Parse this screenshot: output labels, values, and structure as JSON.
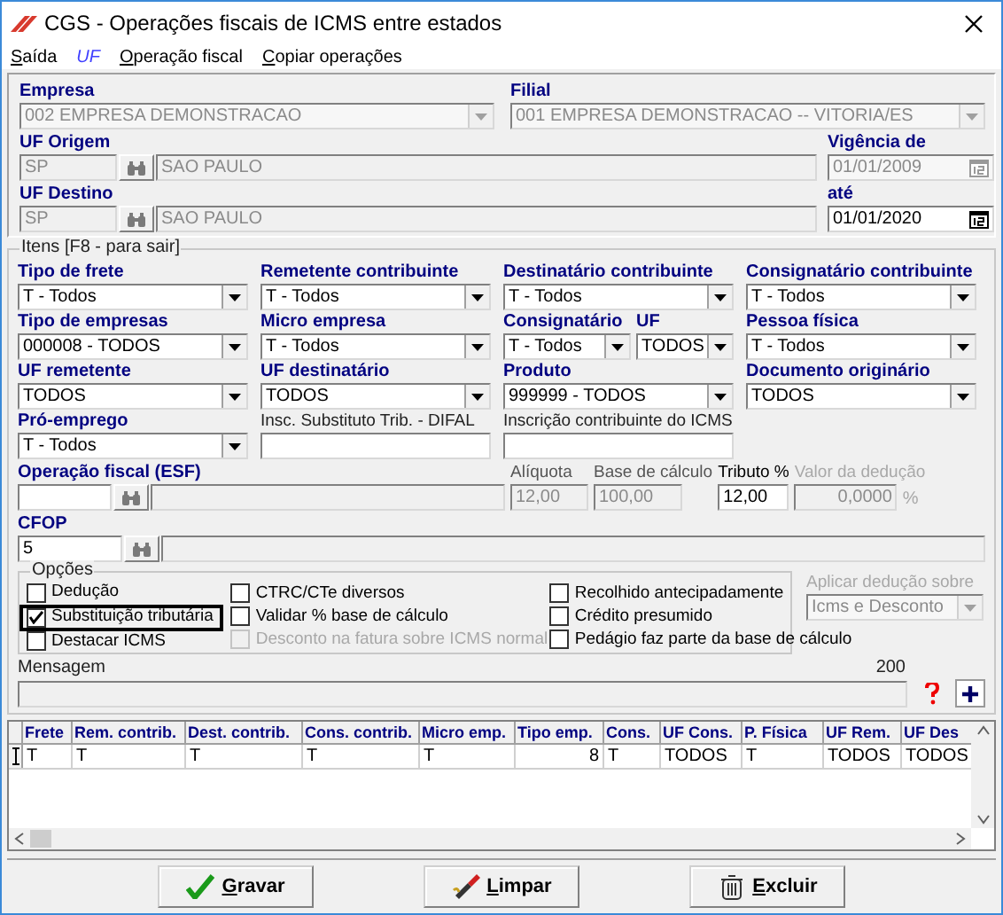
{
  "window": {
    "title": "CGS - Operações fiscais de ICMS entre estados"
  },
  "menu": [
    {
      "label": "Saída",
      "highlighted": false
    },
    {
      "label": "UF",
      "highlighted": true
    },
    {
      "label": "Operação fiscal",
      "highlighted": false
    },
    {
      "label": "Copiar operações",
      "highlighted": false
    }
  ],
  "header": {
    "empresa": {
      "label": "Empresa",
      "value": "002 EMPRESA DEMONSTRACAO",
      "disabled": true
    },
    "filial": {
      "label": "Filial",
      "value": "001 EMPRESA DEMONSTRACAO -- VITORIA/ES",
      "disabled": true
    },
    "uf_origem": {
      "label": "UF Origem",
      "code": "SP",
      "name": "SAO PAULO"
    },
    "vigencia_de": {
      "label": "Vigência de",
      "value": "01/01/2009",
      "disabled": true
    },
    "uf_destino": {
      "label": "UF Destino",
      "code": "SP",
      "name": "SAO PAULO"
    },
    "ate": {
      "label": "até",
      "value": "01/01/2020",
      "disabled": false
    }
  },
  "itens": {
    "title": "Itens [F8 - para sair]",
    "rows": [
      [
        [
          {
            "label": "Tipo de frete",
            "bold": true,
            "kind": "combo",
            "value": "T - Todos"
          }
        ],
        [
          {
            "label": "Remetente contribuinte",
            "bold": true,
            "kind": "combo",
            "value": "T - Todos"
          }
        ],
        [
          {
            "label": "Destinatário contribuinte",
            "bold": true,
            "kind": "combo",
            "value": "T - Todos"
          }
        ],
        [
          {
            "label": "Consignatário contribuinte",
            "bold": true,
            "kind": "combo",
            "value": "T - Todos"
          }
        ]
      ],
      [
        [
          {
            "label": "Tipo de empresas",
            "bold": true,
            "kind": "combo",
            "value": "000008 - TODOS"
          }
        ],
        [
          {
            "label": "Micro empresa",
            "bold": true,
            "kind": "combo",
            "value": "T - Todos"
          }
        ],
        [
          {
            "label": "Consignatário",
            "bold": true,
            "kind": "combo",
            "value": "T - Todos"
          },
          {
            "label": "UF",
            "bold": true,
            "kind": "combo",
            "value": "TODOS"
          }
        ],
        [
          {
            "label": "Pessoa física",
            "bold": true,
            "kind": "combo",
            "value": "T - Todos"
          }
        ]
      ],
      [
        [
          {
            "label": "UF remetente",
            "bold": true,
            "kind": "combo",
            "value": "TODOS"
          }
        ],
        [
          {
            "label": "UF destinatário",
            "bold": true,
            "kind": "combo",
            "value": "TODOS"
          }
        ],
        [
          {
            "label": "Produto",
            "bold": true,
            "kind": "combo",
            "value": "999999 - TODOS"
          }
        ],
        [
          {
            "label": "Documento originário",
            "bold": true,
            "kind": "combo",
            "value": "TODOS"
          }
        ]
      ],
      [
        [
          {
            "label": "Pró-emprego",
            "bold": true,
            "kind": "combo",
            "value": "T - Todos"
          }
        ],
        [
          {
            "label": "Insc. Substituto Trib. - DIFAL",
            "bold": false,
            "kind": "text"
          }
        ],
        [
          {
            "label": "Inscrição contribuinte do ICMS",
            "bold": false,
            "kind": "text"
          }
        ]
      ]
    ]
  },
  "operacao": {
    "label": "Operação fiscal (ESF)",
    "aliquota": {
      "label": "Alíquota",
      "value": "12,00",
      "disabled": true
    },
    "base": {
      "label": "Base de cálculo",
      "value": "100,00",
      "disabled": true
    },
    "tributo": {
      "label": "Tributo %",
      "value": "12,00",
      "disabled": false
    },
    "deducao": {
      "label": "Valor da dedução",
      "value": "0,0000",
      "suffix": "%",
      "disabled": true
    }
  },
  "cfop": {
    "label": "CFOP",
    "code": "5"
  },
  "opcoes": {
    "title": "Opções",
    "columns": [
      [
        {
          "label": "Dedução",
          "checked": false,
          "disabled": false,
          "highlighted": false
        },
        {
          "label": "Substituição tributária",
          "checked": true,
          "disabled": false,
          "highlighted": true
        },
        {
          "label": "Destacar ICMS",
          "checked": false,
          "disabled": false,
          "highlighted": false
        }
      ],
      [
        {
          "label": "CTRC/CTe diversos",
          "checked": false,
          "disabled": false,
          "highlighted": false
        },
        {
          "label": "Validar % base de cálculo",
          "checked": false,
          "disabled": false,
          "highlighted": false
        },
        {
          "label": "Desconto na fatura sobre ICMS normal",
          "checked": false,
          "disabled": true,
          "highlighted": false
        }
      ],
      [
        {
          "label": "Recolhido antecipadamente",
          "checked": false,
          "disabled": false,
          "highlighted": false
        },
        {
          "label": "Crédito presumido",
          "checked": false,
          "disabled": false,
          "highlighted": false
        },
        {
          "label": "Pedágio faz parte da base de cálculo",
          "checked": false,
          "disabled": false,
          "highlighted": false
        }
      ]
    ]
  },
  "aplicar": {
    "label": "Aplicar dedução sobre",
    "value": "Icms e Desconto",
    "disabled": true
  },
  "mensagem": {
    "label": "Mensagem",
    "counter": "200"
  },
  "table": {
    "columns": [
      "Frete",
      "Rem. contrib.",
      "Dest. contrib.",
      "Cons. contrib.",
      "Micro emp.",
      "Tipo emp.",
      "Cons.",
      "UF Cons.",
      "P. Física",
      "UF Rem.",
      "UF Des"
    ],
    "rows": [
      [
        "T",
        "T",
        "T",
        "T",
        "T",
        "8",
        "T",
        "TODOS",
        "T",
        "TODOS",
        "TODOS"
      ]
    ]
  },
  "buttons": [
    {
      "label": "Gravar",
      "kind": "save"
    },
    {
      "label": "Limpar",
      "kind": "clear"
    },
    {
      "label": "Excluir",
      "kind": "delete"
    }
  ]
}
